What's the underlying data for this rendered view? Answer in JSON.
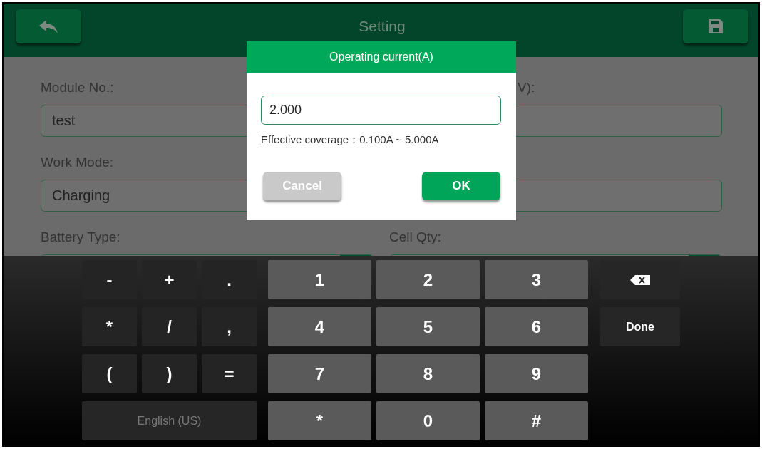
{
  "header": {
    "title": "Setting"
  },
  "form": {
    "left_column": [
      {
        "label": "Module No.:",
        "value": "test",
        "kind": "text"
      },
      {
        "label": "Work Mode:",
        "value": "Charging",
        "kind": "text"
      },
      {
        "label": "Battery Type:",
        "kind": "dropdown"
      }
    ],
    "right_column": [
      {
        "label": "V):",
        "kind": "text"
      },
      {
        "kind": "text"
      },
      {
        "label": "Cell Qty:",
        "kind": "dropdown"
      }
    ]
  },
  "dialog": {
    "title": "Operating current(A)",
    "value": "2.000",
    "hint": "Effective coverage：0.100A ~ 5.000A",
    "buttons": [
      {
        "label": "Cancel",
        "kind": "secondary"
      },
      {
        "label": "OK",
        "kind": "primary"
      }
    ]
  },
  "keyboard": {
    "symbol_keys": [
      "-",
      "+",
      ".",
      "*",
      "/",
      ",",
      "(",
      ")",
      "="
    ],
    "language_key": "English (US)",
    "number_keys": [
      "1",
      "2",
      "3",
      "4",
      "5",
      "6",
      "7",
      "8",
      "9",
      "*",
      "0",
      "#"
    ],
    "action_keys": [
      {
        "kind": "backspace"
      },
      {
        "label": "Done",
        "kind": "text"
      }
    ]
  }
}
